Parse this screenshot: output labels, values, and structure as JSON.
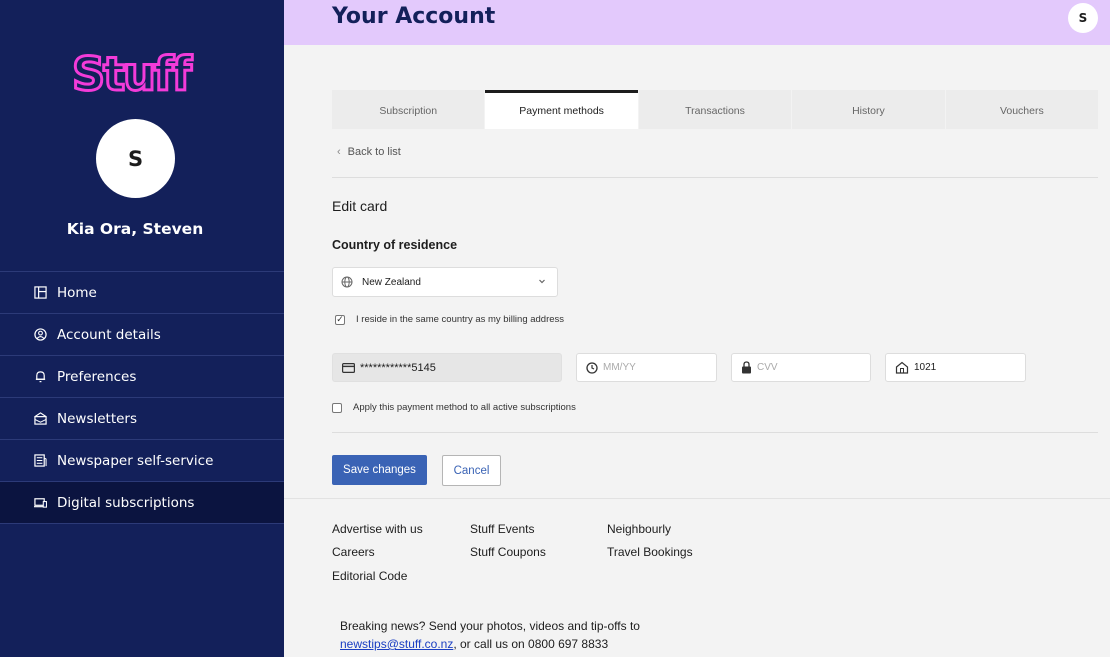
{
  "brand": {
    "logo_text": "Stuff",
    "logo_color": "#f33bd9"
  },
  "user": {
    "initial": "S",
    "greeting": "Kia Ora, Steven"
  },
  "sidebar": {
    "items": [
      {
        "label": "Home",
        "icon": "home-icon"
      },
      {
        "label": "Account details",
        "icon": "account-icon"
      },
      {
        "label": "Preferences",
        "icon": "bell-icon"
      },
      {
        "label": "Newsletters",
        "icon": "envelope-icon"
      },
      {
        "label": "Newspaper self-service",
        "icon": "newspaper-icon"
      },
      {
        "label": "Digital subscriptions",
        "icon": "devices-icon",
        "active": true
      }
    ]
  },
  "header": {
    "title": "Your Account"
  },
  "tabs": [
    {
      "label": "Subscription"
    },
    {
      "label": "Payment methods",
      "active": true
    },
    {
      "label": "Transactions"
    },
    {
      "label": "History"
    },
    {
      "label": "Vouchers"
    }
  ],
  "form": {
    "back_label": "Back to list",
    "title": "Edit card",
    "country_label": "Country of residence",
    "country_value": "New Zealand",
    "same_country_label": "I reside in the same country as my billing address",
    "same_country_checked": true,
    "card_number": "************5145",
    "expiry_placeholder": "MM/YY",
    "cvv_placeholder": "CVV",
    "postcode_value": "1021",
    "apply_all_label": "Apply this payment method to all active subscriptions",
    "apply_all_checked": false,
    "save_label": "Save changes",
    "cancel_label": "Cancel"
  },
  "footer": {
    "links": {
      "advertise": "Advertise with us",
      "careers": "Careers",
      "editorial": "Editorial Code",
      "events": "Stuff Events",
      "coupons": "Stuff Coupons",
      "neighbourly": "Neighbourly",
      "travel": "Travel Bookings"
    },
    "tip_text": "Breaking news? Send your photos, videos and tip-offs to",
    "tip_email": "newstips@stuff.co.nz",
    "tip_phone_text": ", or call us on 0800 697 8833"
  },
  "colors": {
    "sidebar": "#13205a",
    "header": "#e3c9fc",
    "primary_button": "#3a63b5"
  }
}
